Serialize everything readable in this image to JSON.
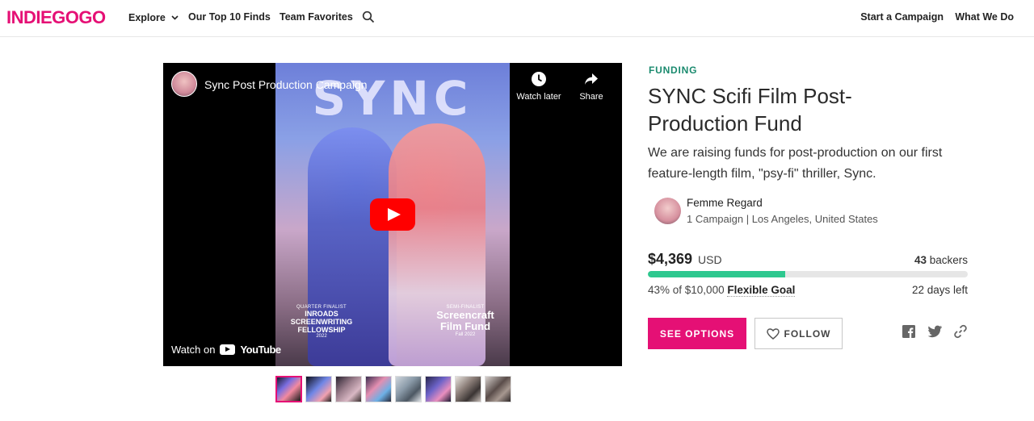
{
  "header": {
    "logo": "INDIEGOGO",
    "nav": {
      "explore": "Explore",
      "top10": "Our Top 10 Finds",
      "favorites": "Team Favorites",
      "start_campaign": "Start a Campaign",
      "what_we_do": "What We Do"
    }
  },
  "video": {
    "channel_title": "Sync Post Production Campaign",
    "poster_logo": "SYNC",
    "watch_later": "Watch later",
    "share": "Share",
    "watch_on": "Watch on",
    "youtube": "YouTube",
    "laurel_1": {
      "small": "QUARTER FINALIST",
      "line1": "INROADS",
      "line2": "SCREENWRITING",
      "line3": "FELLOWSHIP",
      "year": "2022"
    },
    "laurel_2": {
      "small": "SEMI-FINALIST",
      "line1": "Screencraft",
      "line2": "Film Fund",
      "year": "Fall 2022"
    }
  },
  "thumbnails": {
    "count": 8,
    "active_index": 0
  },
  "campaign": {
    "label": "FUNDING",
    "title": "SYNC Scifi Film Post-Production Fund",
    "description": "We are raising funds for post-production on our first feature-length film, \"psy-fi\" thriller, Sync.",
    "owner": {
      "name": "Femme Regard",
      "meta": "1 Campaign | Los Angeles, United States"
    },
    "amount": "$4,369",
    "currency": "USD",
    "backers_count": "43",
    "backers_label": " backers",
    "progress_percent": 43,
    "goal_text": "43% of $10,000 ",
    "goal_type": "Flexible Goal",
    "days_left": "22 days left",
    "see_options": "SEE OPTIONS",
    "follow": "FOLLOW"
  },
  "colors": {
    "brand": "#e51075",
    "funding_label": "#1a8a6e",
    "progress": "#2ec88f"
  },
  "icons": {
    "search": "search-icon",
    "chevron": "chevron-down-icon",
    "clock": "clock-icon",
    "share": "share-arrow-icon",
    "heart": "heart-icon",
    "facebook": "facebook-icon",
    "twitter": "twitter-icon",
    "link": "link-icon"
  }
}
